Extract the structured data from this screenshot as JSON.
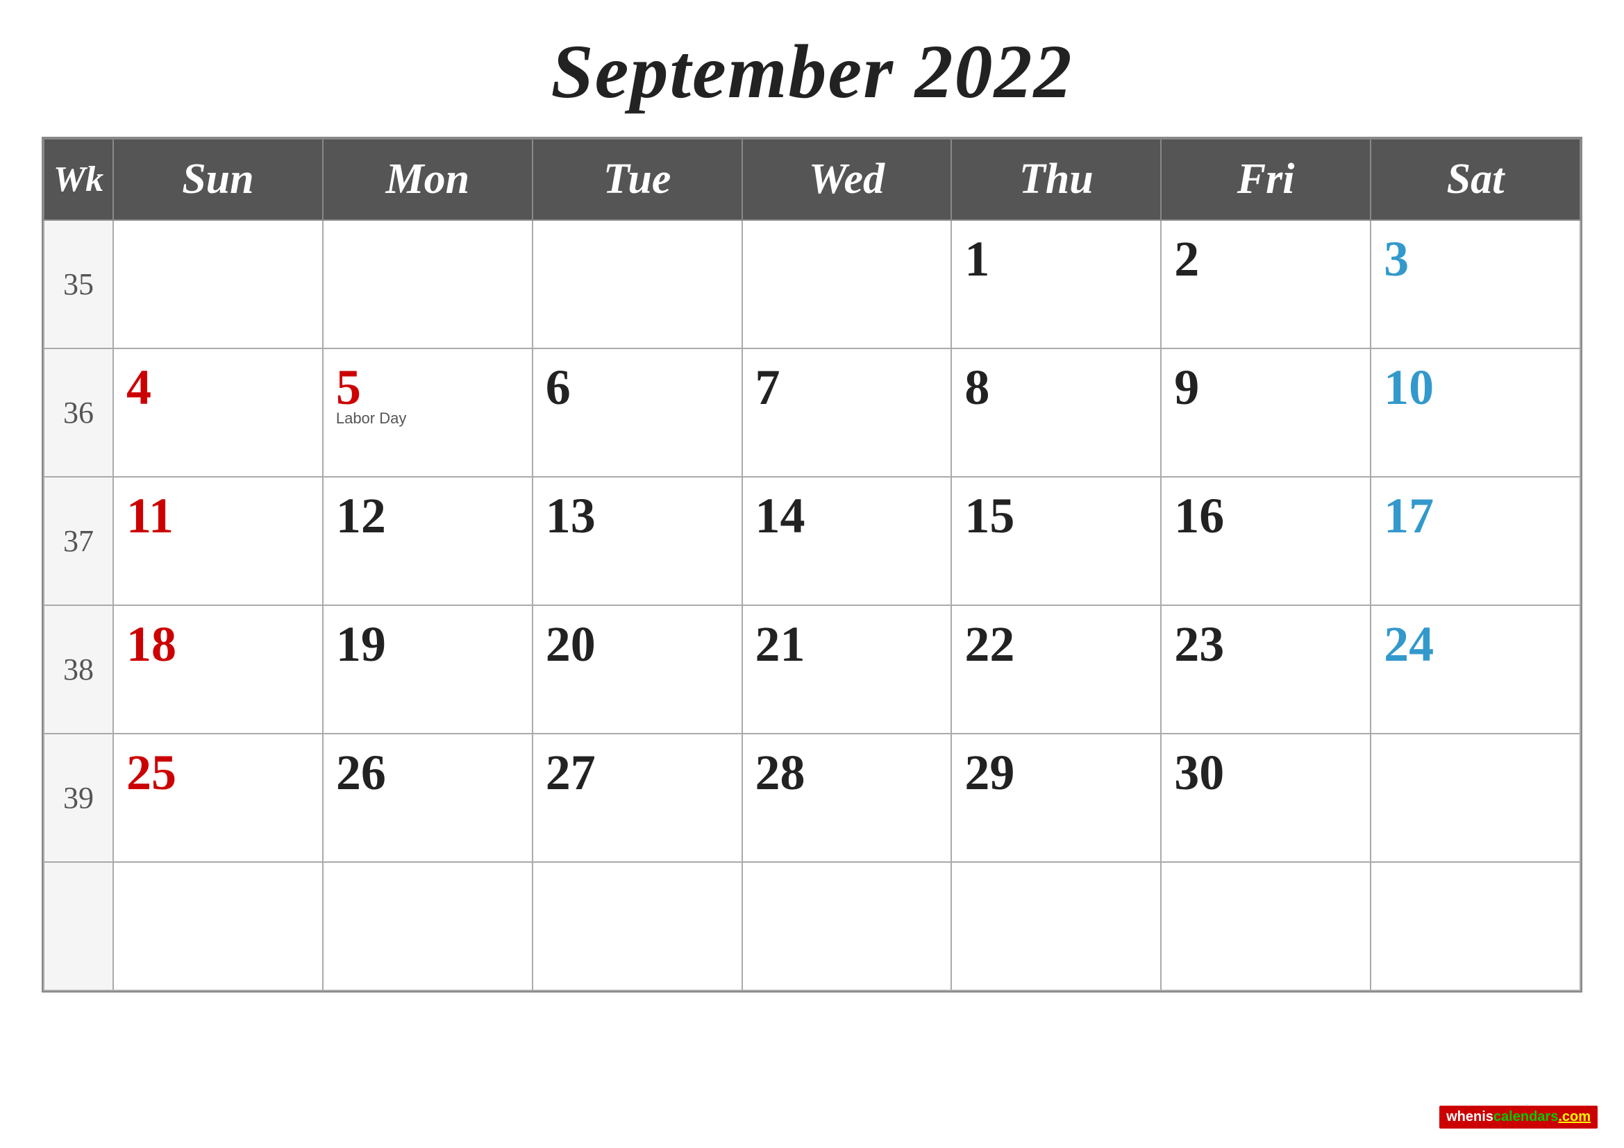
{
  "title": "September 2022",
  "headers": [
    "Wk",
    "Sun",
    "Mon",
    "Tue",
    "Wed",
    "Thu",
    "Fri",
    "Sat"
  ],
  "weeks": [
    {
      "wk": "35",
      "days": [
        {
          "date": "",
          "color": "black"
        },
        {
          "date": "",
          "color": "black"
        },
        {
          "date": "",
          "color": "black"
        },
        {
          "date": "",
          "color": "black"
        },
        {
          "date": "1",
          "color": "black"
        },
        {
          "date": "2",
          "color": "black"
        },
        {
          "date": "3",
          "color": "blue"
        }
      ]
    },
    {
      "wk": "36",
      "days": [
        {
          "date": "4",
          "color": "red"
        },
        {
          "date": "5",
          "color": "red",
          "holiday": "Labor Day"
        },
        {
          "date": "6",
          "color": "black"
        },
        {
          "date": "7",
          "color": "black"
        },
        {
          "date": "8",
          "color": "black"
        },
        {
          "date": "9",
          "color": "black"
        },
        {
          "date": "10",
          "color": "blue"
        }
      ]
    },
    {
      "wk": "37",
      "days": [
        {
          "date": "11",
          "color": "red"
        },
        {
          "date": "12",
          "color": "black"
        },
        {
          "date": "13",
          "color": "black"
        },
        {
          "date": "14",
          "color": "black"
        },
        {
          "date": "15",
          "color": "black"
        },
        {
          "date": "16",
          "color": "black"
        },
        {
          "date": "17",
          "color": "blue"
        }
      ]
    },
    {
      "wk": "38",
      "days": [
        {
          "date": "18",
          "color": "red"
        },
        {
          "date": "19",
          "color": "black"
        },
        {
          "date": "20",
          "color": "black"
        },
        {
          "date": "21",
          "color": "black"
        },
        {
          "date": "22",
          "color": "black"
        },
        {
          "date": "23",
          "color": "black"
        },
        {
          "date": "24",
          "color": "blue"
        }
      ]
    },
    {
      "wk": "39",
      "days": [
        {
          "date": "25",
          "color": "red"
        },
        {
          "date": "26",
          "color": "black"
        },
        {
          "date": "27",
          "color": "black"
        },
        {
          "date": "28",
          "color": "black"
        },
        {
          "date": "29",
          "color": "black"
        },
        {
          "date": "30",
          "color": "black"
        },
        {
          "date": "",
          "color": "black"
        }
      ]
    },
    {
      "wk": "",
      "days": [
        {
          "date": "",
          "color": "black"
        },
        {
          "date": "",
          "color": "black"
        },
        {
          "date": "",
          "color": "black"
        },
        {
          "date": "",
          "color": "black"
        },
        {
          "date": "",
          "color": "black"
        },
        {
          "date": "",
          "color": "black"
        },
        {
          "date": "",
          "color": "black"
        }
      ]
    }
  ],
  "watermark": "wheniscalendars.com"
}
